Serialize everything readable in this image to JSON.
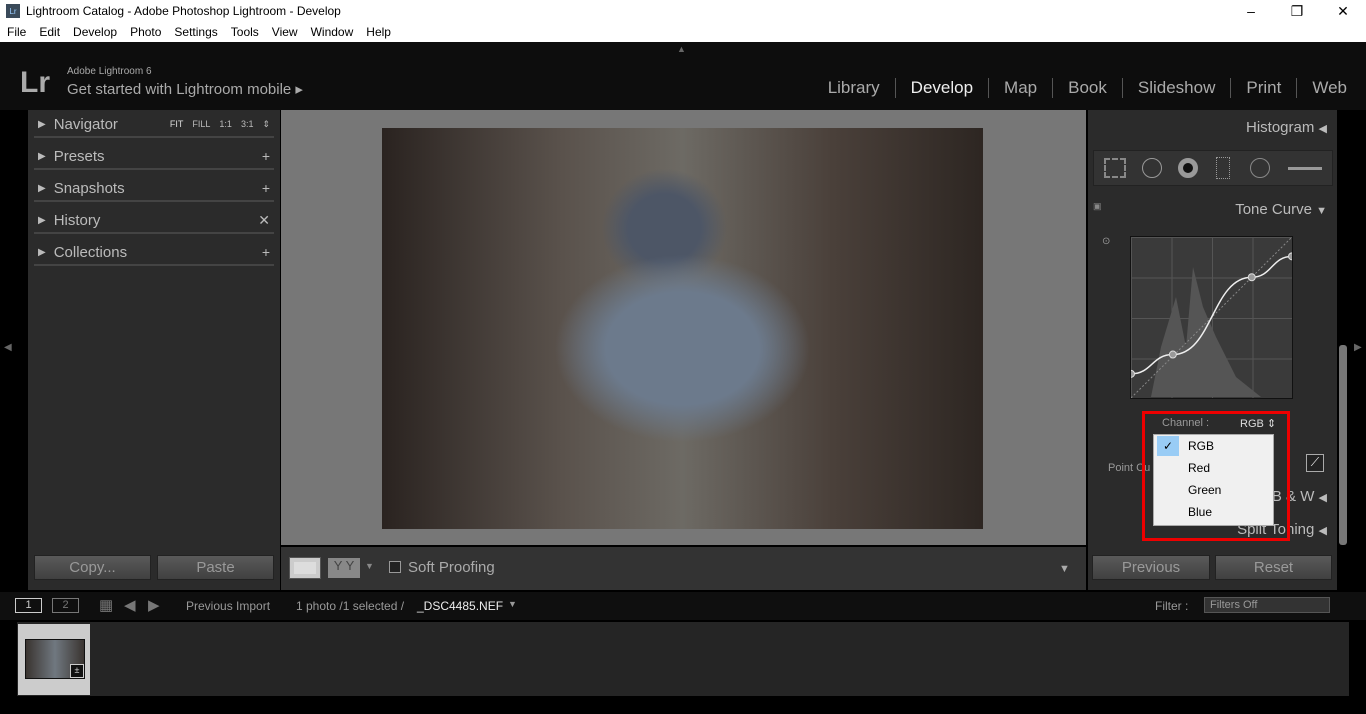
{
  "window": {
    "title": "Lightroom Catalog - Adobe Photoshop Lightroom - Develop",
    "app_icon": "Lr"
  },
  "menu": [
    "File",
    "Edit",
    "Develop",
    "Photo",
    "Settings",
    "Tools",
    "View",
    "Window",
    "Help"
  ],
  "identity": {
    "logo": "Lr",
    "product": "Adobe Lightroom 6",
    "tagline": "Get started with Lightroom mobile ▸"
  },
  "modules": [
    "Library",
    "Develop",
    "Map",
    "Book",
    "Slideshow",
    "Print",
    "Web"
  ],
  "active_module": "Develop",
  "left_panels": [
    {
      "label": "Navigator",
      "action": "⇕"
    },
    {
      "label": "Presets",
      "action": "+"
    },
    {
      "label": "Snapshots",
      "action": "+"
    },
    {
      "label": "History",
      "action": "✕"
    },
    {
      "label": "Collections",
      "action": "+"
    }
  ],
  "navigator_options": [
    "FIT",
    "FILL",
    "1:1",
    "3:1"
  ],
  "left_buttons": {
    "copy": "Copy...",
    "paste": "Paste"
  },
  "right_panels": {
    "histogram": "Histogram",
    "tone_curve": "Tone Curve",
    "bw": "B & W",
    "split": "Split Toning"
  },
  "tone_curve": {
    "channel_label": "Channel :",
    "channel_value": "RGB ⇕",
    "point_curve_label": "Point Cu",
    "points": [
      [
        0,
        0.15
      ],
      [
        0.26,
        0.27
      ],
      [
        0.75,
        0.75
      ],
      [
        1,
        0.88
      ]
    ]
  },
  "channel_dropdown": {
    "options": [
      "RGB",
      "Red",
      "Green",
      "Blue"
    ],
    "selected": "RGB"
  },
  "right_buttons": {
    "previous": "Previous",
    "reset": "Reset"
  },
  "toolbar": {
    "soft_proofing": "Soft Proofing",
    "soft_proofing_checked": false
  },
  "filmstrip": {
    "screen1": "1",
    "screen2": "2",
    "source": "Previous Import",
    "info": "1 photo /1 selected /",
    "filename": "_DSC4485.NEF",
    "filter_label": "Filter :",
    "filter_value": "Filters Off"
  },
  "colors": {
    "highlight": "#e00000",
    "panel": "#2b2b2b",
    "dropdown_check": "#99ccf5"
  }
}
